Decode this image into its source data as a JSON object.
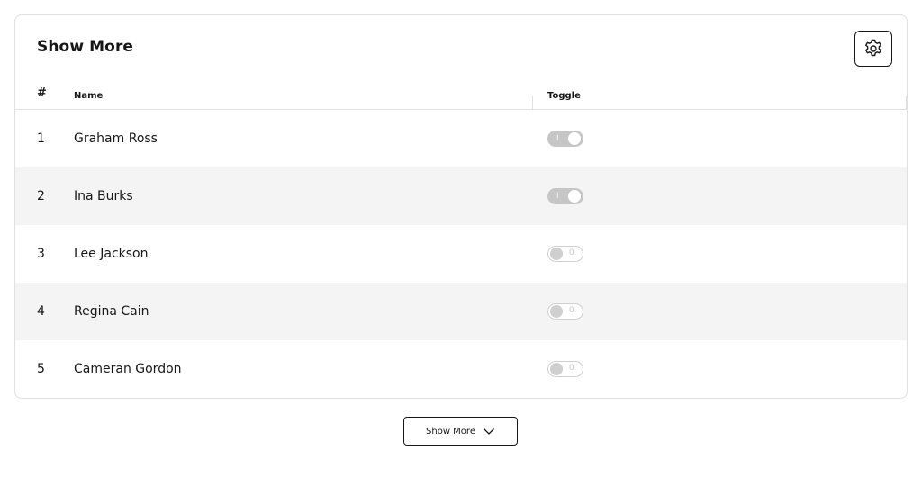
{
  "card": {
    "title": "Show More",
    "settings_icon": "gear-icon"
  },
  "table": {
    "headers": {
      "num": "#",
      "name": "Name",
      "toggle": "Toggle"
    },
    "rows": [
      {
        "num": "1",
        "name": "Graham Ross",
        "toggle_on": true,
        "toggle_text": "I"
      },
      {
        "num": "2",
        "name": "Ina Burks",
        "toggle_on": true,
        "toggle_text": "I"
      },
      {
        "num": "3",
        "name": "Lee Jackson",
        "toggle_on": false,
        "toggle_text": "0"
      },
      {
        "num": "4",
        "name": "Regina Cain",
        "toggle_on": false,
        "toggle_text": "0"
      },
      {
        "num": "5",
        "name": "Cameran Gordon",
        "toggle_on": false,
        "toggle_text": "0"
      }
    ]
  },
  "footer": {
    "show_more_label": "Show More",
    "show_more_icon": "chevron-down-icon"
  },
  "colors": {
    "border": "#e0e0e0",
    "row_alt": "#f4f4f4",
    "text": "#161616",
    "toggle_on": "#c6c6c6"
  }
}
